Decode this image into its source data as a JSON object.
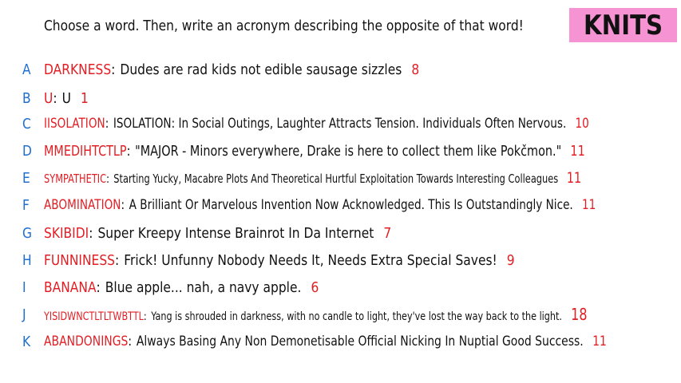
{
  "header": {
    "instruction": "Choose a word. Then, write an acronym describing the opposite of that word!",
    "badge": "KNITS"
  },
  "colors": {
    "letter": "#1f6fd1",
    "word": "#e21e24",
    "count": "#e21e24",
    "badge_bg": "#f593d3"
  },
  "rows": [
    {
      "letter": "A",
      "word": "DARKNESS",
      "acronym": "Dudes are rad kids not edible sausage sizzles",
      "count": "8"
    },
    {
      "letter": "B",
      "word": "U",
      "acronym": "U",
      "count": "1"
    },
    {
      "letter": "C",
      "word": "IISOLATION",
      "acronym": "ISOLATION: In Social Outings, Laughter Attracts Tension. Individuals Often Nervous.",
      "count": "10"
    },
    {
      "letter": "D",
      "word": "MMEDIHTCTLP",
      "acronym": "\"MAJOR - Minors everywhere, Drake is here to collect them like Pokčmon.\"",
      "count": "11"
    },
    {
      "letter": "E",
      "word": "SYMPATHETIC",
      "acronym": "Starting Yucky, Macabre Plots And Theoretical Hurtful Exploitation Towards Interesting Colleagues",
      "count": "11"
    },
    {
      "letter": "F",
      "word": "ABOMINATION",
      "acronym": "A Brilliant Or Marvelous Invention Now Acknowledged. This Is Outstandingly Nice.",
      "count": "11"
    },
    {
      "letter": "G",
      "word": "SKIBIDI",
      "acronym": "Super Kreepy Intense Brainrot In Da Internet",
      "count": "7"
    },
    {
      "letter": "H",
      "word": "FUNNINESS",
      "acronym": "Frick! Unfunny Nobody Needs It, Needs Extra Special Saves!",
      "count": "9"
    },
    {
      "letter": "I",
      "word": "BANANA",
      "acronym": "Blue apple... nah, a navy apple.",
      "count": "6"
    },
    {
      "letter": "J",
      "word": "YISIDWNCTLTLTWBTTL",
      "acronym": "Yang is shrouded in darkness, with no candle to light, they've lost the way back to the light.",
      "count": "18"
    },
    {
      "letter": "K",
      "word": "ABANDONINGS",
      "acronym": "Always Basing Any Non Demonetisable Official Nicking In Nuptial Good Success.",
      "count": "11"
    }
  ]
}
